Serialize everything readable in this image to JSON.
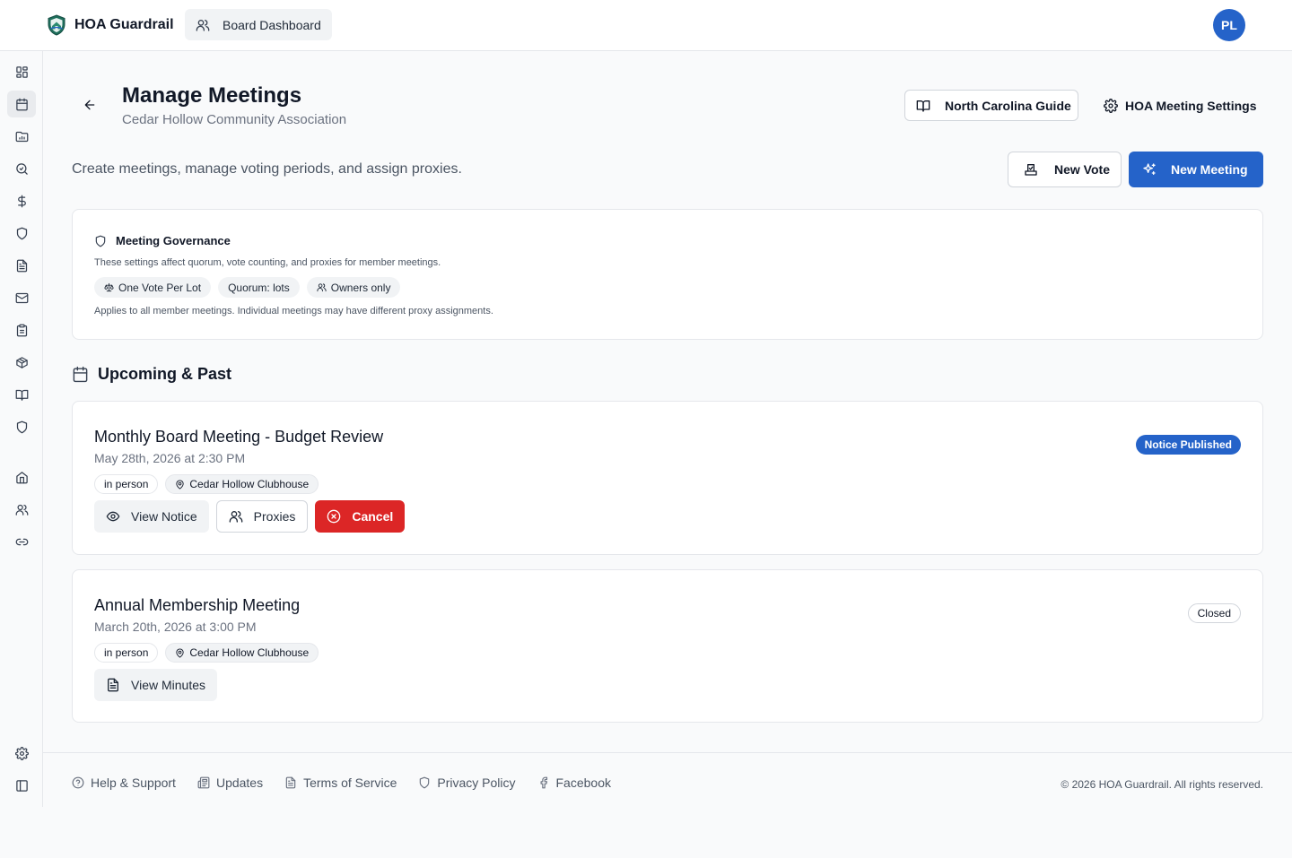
{
  "app": {
    "name": "HOA Guardrail",
    "brand_color": "#2563c9",
    "danger_color": "#dc2626"
  },
  "topbar": {
    "dashboard_label": "Board Dashboard",
    "avatar_initials": "PL"
  },
  "sidebar": {
    "items": [
      {
        "icon": "dashboard-icon"
      },
      {
        "icon": "calendar-icon",
        "active": true
      },
      {
        "icon": "folder-chart-icon"
      },
      {
        "icon": "search-icon"
      },
      {
        "icon": "dollar-icon"
      },
      {
        "icon": "shield-icon"
      },
      {
        "icon": "document-icon"
      },
      {
        "icon": "mail-icon"
      },
      {
        "icon": "clipboard-icon"
      },
      {
        "icon": "package-icon"
      },
      {
        "icon": "book-icon"
      },
      {
        "icon": "shield-icon"
      },
      {
        "icon": "home-icon"
      },
      {
        "icon": "users-icon"
      },
      {
        "icon": "link-icon"
      }
    ],
    "bottom": [
      {
        "icon": "gear-icon"
      },
      {
        "icon": "panel-toggle-icon"
      }
    ]
  },
  "header": {
    "title": "Manage Meetings",
    "subtitle": "Cedar Hollow Community Association",
    "guide_label": "North Carolina Guide",
    "settings_label": "HOA Meeting Settings",
    "intro": "Create meetings, manage voting periods, and assign proxies.",
    "new_vote_label": "New Vote",
    "new_meeting_label": "New Meeting"
  },
  "governance": {
    "title": "Meeting Governance",
    "description": "These settings affect quorum, vote counting, and proxies for member meetings.",
    "chips": [
      "One Vote Per Lot",
      "Quorum: lots",
      "Owners only"
    ],
    "note": "Applies to all member meetings. Individual meetings may have different proxy assignments."
  },
  "meetings_section": {
    "title": "Upcoming & Past",
    "meetings": [
      {
        "title": "Monthly Board Meeting - Budget Review",
        "date": "May 28th, 2026 at 2:30 PM",
        "format": "in person",
        "location": "Cedar Hollow Clubhouse",
        "status": "Notice Published",
        "actions": [
          "View Notice",
          "Proxies",
          "Cancel"
        ]
      },
      {
        "title": "Annual Membership Meeting",
        "date": "March 20th, 2026 at 3:00 PM",
        "format": "in person",
        "location": "Cedar Hollow Clubhouse",
        "status": "Closed",
        "actions": [
          "View Minutes"
        ]
      }
    ]
  },
  "footer": {
    "links": [
      "Help & Support",
      "Updates",
      "Terms of Service",
      "Privacy Policy",
      "Facebook"
    ],
    "copyright": "© 2026 HOA Guardrail. All rights reserved."
  }
}
